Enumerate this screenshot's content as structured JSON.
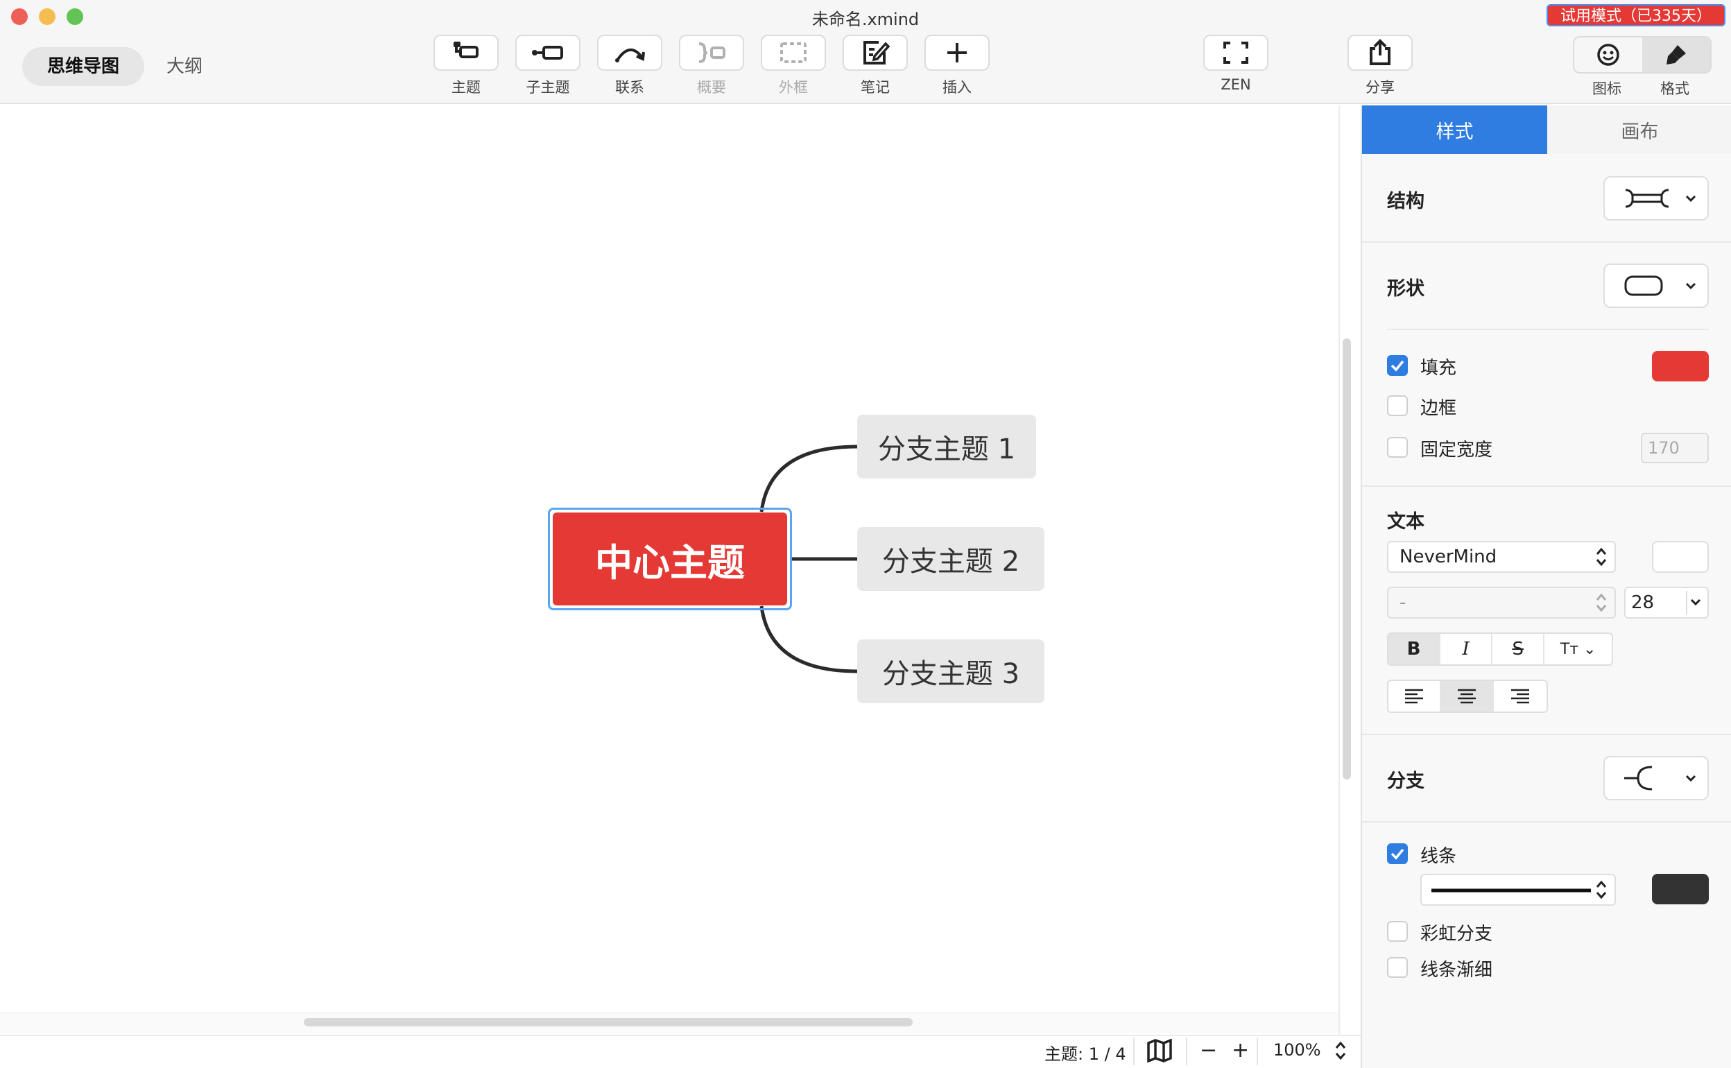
{
  "window": {
    "title": "未命名.xmind",
    "trial_badge": "试用模式（已335天）"
  },
  "view_tabs": {
    "mindmap": "思维导图",
    "outline": "大纲"
  },
  "toolbar": {
    "topic": "主题",
    "subtopic": "子主题",
    "relationship": "联系",
    "summary": "概要",
    "boundary": "外框",
    "note": "笔记",
    "insert": "插入",
    "zen": "ZEN",
    "share": "分享",
    "icon": "图标",
    "format": "格式"
  },
  "mindmap": {
    "central_topic": "中心主题",
    "branches": [
      "分支主题 1",
      "分支主题 2",
      "分支主题 3"
    ],
    "central_color": "#e53935",
    "line_color": "#2b2b2b"
  },
  "status": {
    "topic_count": "主题: 1 / 4",
    "zoom": "100%",
    "zoom_out": "−",
    "zoom_in": "+"
  },
  "panel": {
    "tabs": {
      "style": "样式",
      "canvas": "画布"
    },
    "structure_label": "结构",
    "shape_label": "形状",
    "fill_label": "填充",
    "fill_checked": true,
    "fill_color": "#e53935",
    "border_label": "边框",
    "border_checked": false,
    "fixed_width_label": "固定宽度",
    "fixed_width_checked": false,
    "fixed_width_value": "170",
    "text_label": "文本",
    "font_name": "NeverMind",
    "font_weight": "-",
    "font_size": "28",
    "text_align": "center",
    "bold_active": true,
    "branch_label": "分支",
    "line_label": "线条",
    "line_checked": true,
    "line_color": "#333333",
    "rainbow_label": "彩虹分支",
    "rainbow_checked": false,
    "taper_label": "线条渐细",
    "taper_checked": false
  }
}
